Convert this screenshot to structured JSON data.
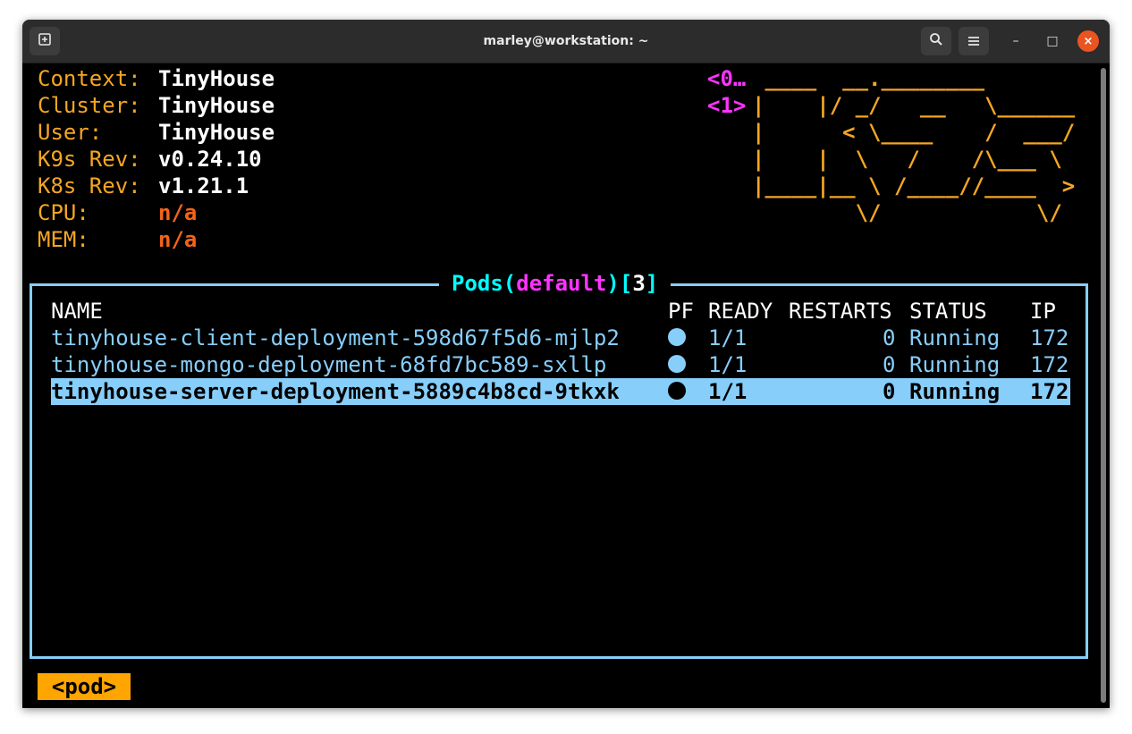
{
  "window": {
    "title": "marley@workstation: ~",
    "new_tab_icon": "new-tab-icon",
    "search_icon": "search-icon",
    "menu_icon": "hamburger-menu-icon",
    "minimize": "–",
    "maximize": "□",
    "close": "×"
  },
  "info": [
    {
      "label": "Context:",
      "value": "TinyHouse",
      "highlight": false
    },
    {
      "label": "Cluster:",
      "value": "TinyHouse",
      "highlight": false
    },
    {
      "label": "User:",
      "value": "TinyHouse",
      "highlight": false
    },
    {
      "label": "K9s Rev:",
      "value": "v0.24.10",
      "highlight": false
    },
    {
      "label": "K8s Rev:",
      "value": "v1.21.1",
      "highlight": false
    },
    {
      "label": "CPU:",
      "value": "n/a",
      "highlight": true
    },
    {
      "label": "MEM:",
      "value": "n/a",
      "highlight": true
    }
  ],
  "shortcuts": [
    {
      "key": "<0…",
      "label": ""
    },
    {
      "key": "<1>",
      "label": ""
    }
  ],
  "logo_lines": [
    " ____  __.________        ",
    "|    |/ _/   __   \\______ ",
    "|      < \\____    /  ___/ ",
    "|    |  \\   /    /\\___ \\  ",
    "|____|__ \\ /____//____  > ",
    "        \\/            \\/  "
  ],
  "panel": {
    "resource": "Pods",
    "paren_open": "(",
    "namespace": "default",
    "paren_close": ")",
    "bracket_open": "[",
    "count": "3",
    "bracket_close": "]"
  },
  "table": {
    "headers": {
      "name": "NAME",
      "pf": "PF",
      "ready": "READY",
      "restarts": "RESTARTS",
      "status": "STATUS",
      "ip": "IP"
    },
    "rows": [
      {
        "name": "tinyhouse-client-deployment-598d67f5d6-mjlp2",
        "pf": "●",
        "ready": "1/1",
        "restarts": "0",
        "status": "Running",
        "ip": "172",
        "selected": false
      },
      {
        "name": "tinyhouse-mongo-deployment-68fd7bc589-sxllp",
        "pf": "●",
        "ready": "1/1",
        "restarts": "0",
        "status": "Running",
        "ip": "172",
        "selected": false
      },
      {
        "name": "tinyhouse-server-deployment-5889c4b8cd-9tkxk",
        "pf": "●",
        "ready": "1/1",
        "restarts": "0",
        "status": "Running",
        "ip": "172",
        "selected": true
      }
    ]
  },
  "crumb": "<pod>",
  "colors": {
    "label": "#f5a623",
    "accent": "#87cefa",
    "magenta": "#ff33ff",
    "cyan": "#00ffff",
    "orange": "#f26419",
    "crumb_bg": "#ffa500"
  }
}
